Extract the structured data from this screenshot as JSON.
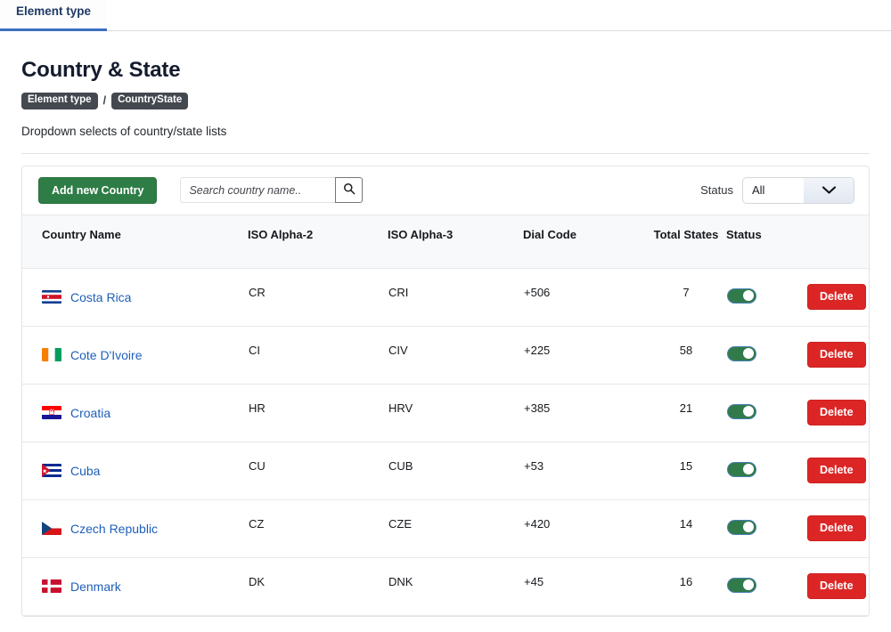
{
  "tabs": [
    {
      "label": "Element type",
      "active": true
    }
  ],
  "page": {
    "title": "Country & State",
    "breadcrumb": {
      "parent": "Element type",
      "separator": "/",
      "current": "CountryState"
    },
    "description": "Dropdown selects of country/state lists"
  },
  "toolbar": {
    "add_label": "Add new Country",
    "search_placeholder": "Search country name..",
    "search_value": "",
    "search_icon": "search-icon",
    "status_label": "Status",
    "status_value": "All",
    "status_options": [
      "All"
    ],
    "chevron_icon": "chevron-down-icon"
  },
  "table": {
    "columns": [
      "Country Name",
      "ISO Alpha-2",
      "ISO Alpha-3",
      "Dial Code",
      "Total States",
      "Status",
      ""
    ],
    "action_label": "Delete",
    "rows": [
      {
        "name": "Costa Rica",
        "alpha2": "CR",
        "alpha3": "CRI",
        "dial": "+506",
        "states": "7",
        "enabled": true,
        "flag": "costa-rica-flag"
      },
      {
        "name": "Cote D'Ivoire",
        "alpha2": "CI",
        "alpha3": "CIV",
        "dial": "+225",
        "states": "58",
        "enabled": true,
        "flag": "cote-divoire-flag"
      },
      {
        "name": "Croatia",
        "alpha2": "HR",
        "alpha3": "HRV",
        "dial": "+385",
        "states": "21",
        "enabled": true,
        "flag": "croatia-flag"
      },
      {
        "name": "Cuba",
        "alpha2": "CU",
        "alpha3": "CUB",
        "dial": "+53",
        "states": "15",
        "enabled": true,
        "flag": "cuba-flag"
      },
      {
        "name": "Czech Republic",
        "alpha2": "CZ",
        "alpha3": "CZE",
        "dial": "+420",
        "states": "14",
        "enabled": true,
        "flag": "czech-republic-flag"
      },
      {
        "name": "Denmark",
        "alpha2": "DK",
        "alpha3": "DNK",
        "dial": "+45",
        "states": "16",
        "enabled": true,
        "flag": "denmark-flag"
      }
    ]
  },
  "colors": {
    "tab_accent": "#3a6fbf",
    "add_button": "#2f7d46",
    "delete_button": "#dc2626",
    "toggle_on": "#317a4a",
    "link": "#1e5fb8",
    "breadcrumb_badge": "#44484f"
  }
}
